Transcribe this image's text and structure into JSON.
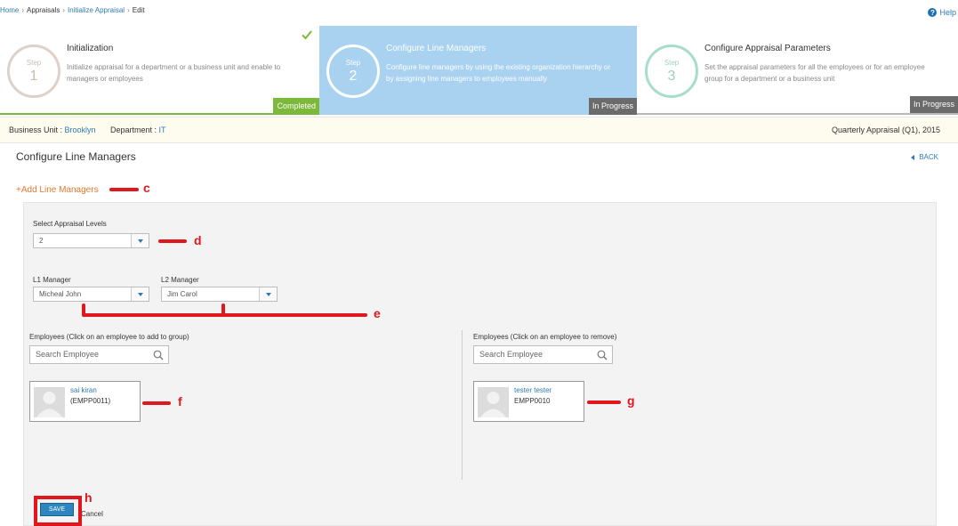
{
  "breadcrumb": {
    "home": "Home",
    "appraisals": "Appraisals",
    "initialize": "Initialize Appraisal",
    "edit": "Edit",
    "separator": "›"
  },
  "help": {
    "label": "Help",
    "icon": "?"
  },
  "steps": [
    {
      "step_word": "Step",
      "number": "1",
      "title": "Initialization",
      "description": "Initialize appraisal for a department or a business unit and enable to managers or employees",
      "status": "Completed"
    },
    {
      "step_word": "Step",
      "number": "2",
      "title": "Configure Line Managers",
      "description": "Configure line managers by using the existing organization hierarchy or by assigning line managers to employees manually",
      "status": "In Progress"
    },
    {
      "step_word": "Step",
      "number": "3",
      "title": "Configure Appraisal Parameters",
      "description": "Set the appraisal parameters for all the employees or for an employee group for a department or a business unit",
      "status": "In Progress"
    }
  ],
  "info": {
    "business_unit_label": "Business Unit :",
    "business_unit_value": "Brooklyn",
    "department_label": "Department :",
    "department_value": "IT",
    "cycle": "Quarterly Appraisal (Q1), 2015"
  },
  "page": {
    "title": "Configure Line Managers",
    "back_label": "BACK",
    "add_link": "+Add Line Managers"
  },
  "form": {
    "levels_label": "Select Appraisal Levels",
    "levels_value": "2",
    "l1_label": "L1 Manager",
    "l1_value": "Micheal John",
    "l2_label": "L2 Manager",
    "l2_value": "Jim Carol"
  },
  "left_list": {
    "heading": "Employees (Click on an employee to add to group)",
    "search_placeholder": "Search Employee",
    "employees": [
      {
        "name": "sai kiran",
        "code": "(EMPP0011)"
      }
    ]
  },
  "right_list": {
    "heading": "Employees (Click on an employee to remove)",
    "search_placeholder": "Search Employee",
    "employees": [
      {
        "name": "tester tester",
        "code": "EMPP0010"
      }
    ]
  },
  "actions": {
    "save": "SAVE",
    "cancel": "Cancel"
  },
  "annotations": {
    "c": "c",
    "d": "d",
    "e": "e",
    "f": "f",
    "g": "g",
    "h": "h"
  },
  "colors": {
    "accent_blue": "#2e7ab8",
    "step_active_bg": "#a9d1f0",
    "completed_green": "#7cb93a",
    "in_progress_gray": "#6b6b6b",
    "add_link_orange": "#e07a2e",
    "annotation_red": "#e0181d"
  }
}
